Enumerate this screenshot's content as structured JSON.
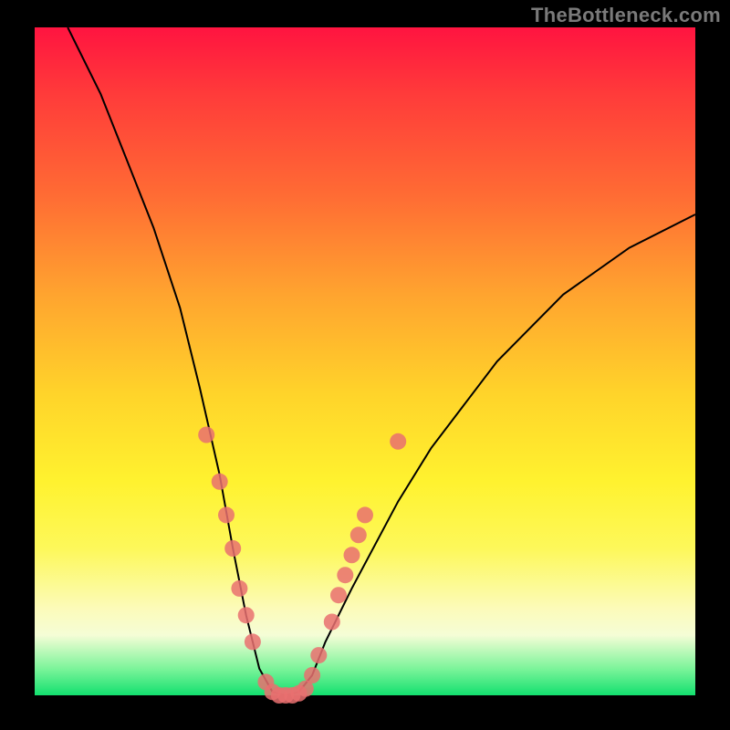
{
  "watermark": "TheBottleneck.com",
  "colors": {
    "dot": "#e97070",
    "curve": "#000000",
    "gradient_stops": [
      "#ff1440",
      "#ff3b3a",
      "#ff6b34",
      "#ffa42f",
      "#ffd42a",
      "#fff22f",
      "#fdf85a",
      "#fcfbb9",
      "#f5fdd6",
      "#7cf49a",
      "#13e06f"
    ]
  },
  "chart_data": {
    "type": "line",
    "title": "",
    "xlabel": "",
    "ylabel": "",
    "xlim": [
      0,
      100
    ],
    "ylim": [
      0,
      100
    ],
    "x_min_at": 38,
    "series": [
      {
        "name": "bottleneck-curve",
        "x": [
          5,
          10,
          14,
          18,
          22,
          25,
          28,
          30,
          32,
          34,
          36,
          38,
          40,
          42,
          44,
          48,
          55,
          60,
          70,
          80,
          90,
          100
        ],
        "y": [
          100,
          90,
          80,
          70,
          58,
          46,
          33,
          22,
          12,
          4,
          0.5,
          0,
          0.5,
          3,
          8,
          16,
          29,
          37,
          50,
          60,
          67,
          72
        ]
      }
    ],
    "markers": {
      "name": "highlight-dots",
      "points": [
        {
          "x": 26,
          "y": 39
        },
        {
          "x": 28,
          "y": 32
        },
        {
          "x": 29,
          "y": 27
        },
        {
          "x": 30,
          "y": 22
        },
        {
          "x": 31,
          "y": 16
        },
        {
          "x": 32,
          "y": 12
        },
        {
          "x": 33,
          "y": 8
        },
        {
          "x": 35,
          "y": 2
        },
        {
          "x": 36,
          "y": 0.5
        },
        {
          "x": 37,
          "y": 0
        },
        {
          "x": 38,
          "y": 0
        },
        {
          "x": 39,
          "y": 0
        },
        {
          "x": 40,
          "y": 0.3
        },
        {
          "x": 41,
          "y": 1
        },
        {
          "x": 42,
          "y": 3
        },
        {
          "x": 43,
          "y": 6
        },
        {
          "x": 45,
          "y": 11
        },
        {
          "x": 46,
          "y": 15
        },
        {
          "x": 47,
          "y": 18
        },
        {
          "x": 48,
          "y": 21
        },
        {
          "x": 49,
          "y": 24
        },
        {
          "x": 50,
          "y": 27
        },
        {
          "x": 55,
          "y": 38
        }
      ]
    }
  }
}
